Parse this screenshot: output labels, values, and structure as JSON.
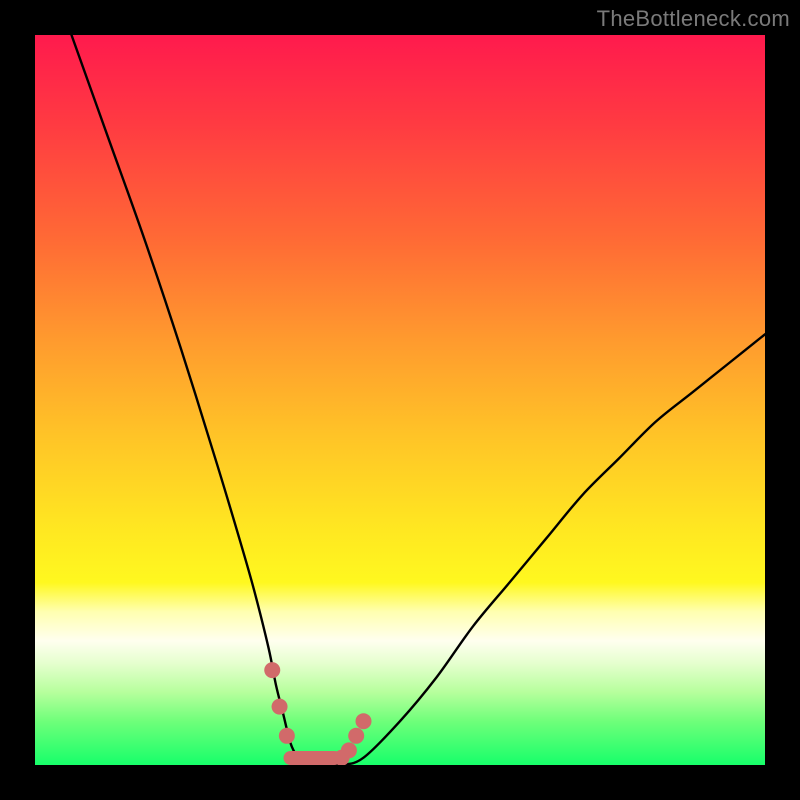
{
  "watermark": "TheBottleneck.com",
  "chart_data": {
    "type": "line",
    "title": "",
    "xlabel": "",
    "ylabel": "",
    "xlim": [
      0,
      100
    ],
    "ylim": [
      0,
      100
    ],
    "series": [
      {
        "name": "bottleneck-curve",
        "x": [
          5,
          10,
          15,
          20,
          25,
          28,
          30,
          32,
          33,
          34,
          35,
          36,
          37,
          38,
          40,
          42,
          45,
          50,
          55,
          60,
          65,
          70,
          75,
          80,
          85,
          90,
          95,
          100
        ],
        "y": [
          100,
          86,
          72,
          57,
          41,
          31,
          24,
          16,
          11,
          7,
          3,
          1,
          0,
          0,
          0,
          0,
          1,
          6,
          12,
          19,
          25,
          31,
          37,
          42,
          47,
          51,
          55,
          59
        ]
      }
    ],
    "markers": {
      "name": "highlight-range",
      "x": [
        32.5,
        33.5,
        34.5,
        42,
        43,
        44,
        45
      ],
      "y": [
        13,
        8,
        4,
        1,
        2,
        4,
        6
      ]
    },
    "flat_segment": {
      "x0": 35,
      "x1": 41,
      "y": 0
    }
  }
}
